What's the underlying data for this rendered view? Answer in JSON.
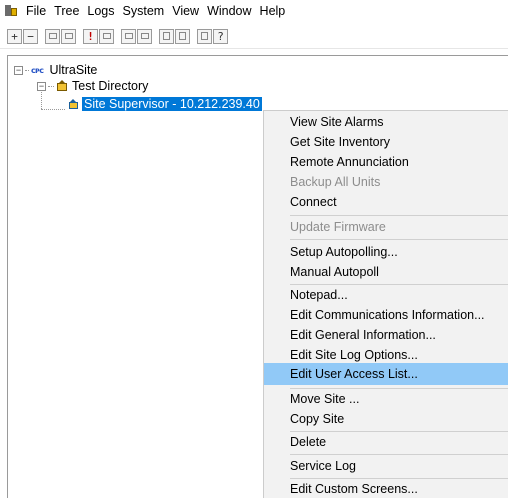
{
  "menubar": {
    "items": [
      "File",
      "Tree",
      "Logs",
      "System",
      "View",
      "Window",
      "Help"
    ]
  },
  "toolbar": {
    "buttons": [
      {
        "icon": "plus-icon",
        "glyph": "+"
      },
      {
        "icon": "minus-icon",
        "glyph": "−"
      },
      {
        "icon": "grid-view-icon",
        "glyph": ""
      },
      {
        "icon": "grid-view-alt-icon",
        "glyph": ""
      },
      {
        "icon": "alarm-icon",
        "glyph": "!"
      },
      {
        "icon": "window-icon",
        "glyph": ""
      },
      {
        "icon": "monitor-icon",
        "glyph": ""
      },
      {
        "icon": "monitor-alt-icon",
        "glyph": ""
      },
      {
        "icon": "connect-icon",
        "glyph": ""
      },
      {
        "icon": "disconnect-icon",
        "glyph": ""
      },
      {
        "icon": "document-icon",
        "glyph": ""
      },
      {
        "icon": "help-icon",
        "glyph": "?"
      }
    ]
  },
  "tree": {
    "root": {
      "label": "UltraSite",
      "icon": "network-icon",
      "icon_text": "ᴄᴘᴄ",
      "expander": "−"
    },
    "directory": {
      "label": "Test Directory",
      "icon": "directory-icon",
      "expander": "−"
    },
    "site": {
      "label": "Site Supervisor - 10.212.239.40",
      "icon": "site-icon",
      "selected": true
    }
  },
  "context_menu": {
    "groups": [
      [
        {
          "label": "View Site Alarms",
          "enabled": true
        },
        {
          "label": "Get Site Inventory",
          "enabled": true
        },
        {
          "label": "Remote Annunciation",
          "enabled": true
        },
        {
          "label": "Backup All Units",
          "enabled": false
        },
        {
          "label": "Connect",
          "enabled": true
        }
      ],
      [
        {
          "label": "Update Firmware",
          "enabled": false
        }
      ],
      [
        {
          "label": "Setup Autopolling...",
          "enabled": true
        },
        {
          "label": "Manual Autopoll",
          "enabled": true
        }
      ],
      [
        {
          "label": "Notepad...",
          "enabled": true
        },
        {
          "label": "Edit Communications Information...",
          "enabled": true
        },
        {
          "label": "Edit General Information...",
          "enabled": true
        },
        {
          "label": "Edit Site Log Options...",
          "enabled": true
        },
        {
          "label": "Edit User Access List...",
          "enabled": true,
          "highlighted": true
        }
      ],
      [
        {
          "label": "Move Site ...",
          "enabled": true
        },
        {
          "label": "Copy Site",
          "enabled": true
        }
      ],
      [
        {
          "label": "Delete",
          "enabled": true
        }
      ],
      [
        {
          "label": "Service Log",
          "enabled": true
        }
      ],
      [
        {
          "label": "Edit Custom Screens...",
          "enabled": true
        }
      ]
    ]
  },
  "colors": {
    "selection": "#0078d7",
    "menu_highlight": "#91c9f7",
    "menu_bg": "#f2f2f2",
    "disabled_text": "#8d8d8d"
  }
}
